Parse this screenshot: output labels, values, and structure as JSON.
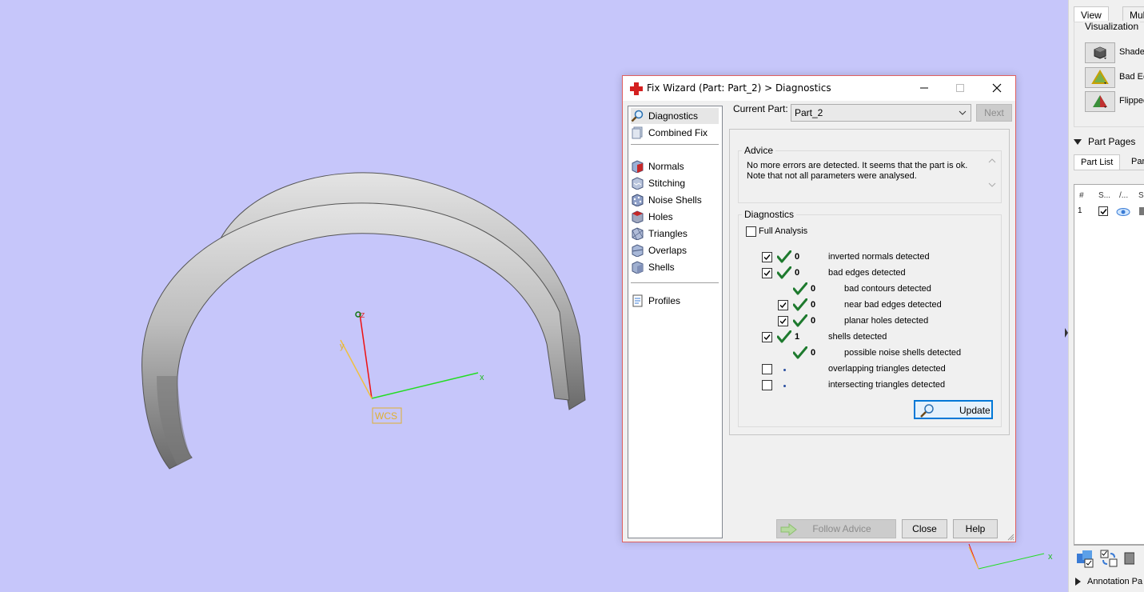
{
  "viewport": {
    "wcs_label": "WCS",
    "axis_x": "x",
    "axis_y": "y",
    "axis_z": "z",
    "mini_axis_x": "x"
  },
  "right_panel": {
    "tabs": [
      "View",
      "Mul"
    ],
    "visualization_label": "Visualization",
    "vis_buttons": [
      "Shade",
      "Bad Ec",
      "Flipped"
    ],
    "part_pages_label": "Part Pages",
    "subtabs": [
      "Part List",
      "Par"
    ],
    "columns": [
      "#",
      "S...",
      "/...",
      "S"
    ],
    "rows": [
      {
        "num": "1",
        "checked": true
      }
    ],
    "annotation_label": "Annotation Pa"
  },
  "dialog": {
    "title": "Fix Wizard (Part: Part_2) > Diagnostics",
    "nav": {
      "top": [
        {
          "label": "Diagnostics",
          "icon": "magnifier-icon",
          "selected": true
        },
        {
          "label": "Combined Fix",
          "icon": "combined-fix-icon",
          "selected": false
        }
      ],
      "tools": [
        {
          "label": "Normals",
          "icon": "normals-icon"
        },
        {
          "label": "Stitching",
          "icon": "stitching-icon"
        },
        {
          "label": "Noise Shells",
          "icon": "noise-shells-icon"
        },
        {
          "label": "Holes",
          "icon": "holes-icon"
        },
        {
          "label": "Triangles",
          "icon": "triangles-icon"
        },
        {
          "label": "Overlaps",
          "icon": "overlaps-icon"
        },
        {
          "label": "Shells",
          "icon": "shells-icon"
        }
      ],
      "bottom": [
        {
          "label": "Profiles",
          "icon": "profiles-icon"
        }
      ]
    },
    "current_part_label": "Current Part:",
    "current_part_value": "Part_2",
    "next_label": "Next",
    "advice_title": "Advice",
    "advice_text": "No more errors are detected. It seems that the part is ok. Note that not all parameters were analysed.",
    "diagnostics_title": "Diagnostics",
    "full_analysis_label": "Full Analysis",
    "full_analysis_checked": false,
    "rows": [
      {
        "checkbox": true,
        "checked": true,
        "status": "ok",
        "count": "0",
        "label": "inverted normals detected",
        "indent": 0
      },
      {
        "checkbox": true,
        "checked": true,
        "status": "ok",
        "count": "0",
        "label": "bad edges detected",
        "indent": 0
      },
      {
        "checkbox": false,
        "checked": false,
        "status": "ok",
        "count": "0",
        "label": "bad contours detected",
        "indent": 1
      },
      {
        "checkbox": true,
        "checked": true,
        "status": "ok",
        "count": "0",
        "label": "near bad edges detected",
        "indent": 1
      },
      {
        "checkbox": true,
        "checked": true,
        "status": "ok",
        "count": "0",
        "label": "planar holes detected",
        "indent": 1
      },
      {
        "checkbox": true,
        "checked": true,
        "status": "ok",
        "count": "1",
        "label": "shells detected",
        "indent": 0
      },
      {
        "checkbox": false,
        "checked": false,
        "status": "ok",
        "count": "0",
        "label": "possible noise shells detected",
        "indent": 1
      },
      {
        "checkbox": true,
        "checked": false,
        "status": "pending",
        "count": "",
        "label": "overlapping triangles detected",
        "indent": 0
      },
      {
        "checkbox": true,
        "checked": false,
        "status": "pending",
        "count": "",
        "label": "intersecting triangles detected",
        "indent": 0
      }
    ],
    "update_label": "Update",
    "follow_advice_label": "Follow Advice",
    "close_label": "Close",
    "help_label": "Help"
  },
  "colors": {
    "viewport_bg": "#c6c6fa",
    "check_green": "#1e7a2e",
    "axis_x": "#22dd22",
    "axis_y": "#f0c040",
    "axis_z": "#ee1111"
  }
}
